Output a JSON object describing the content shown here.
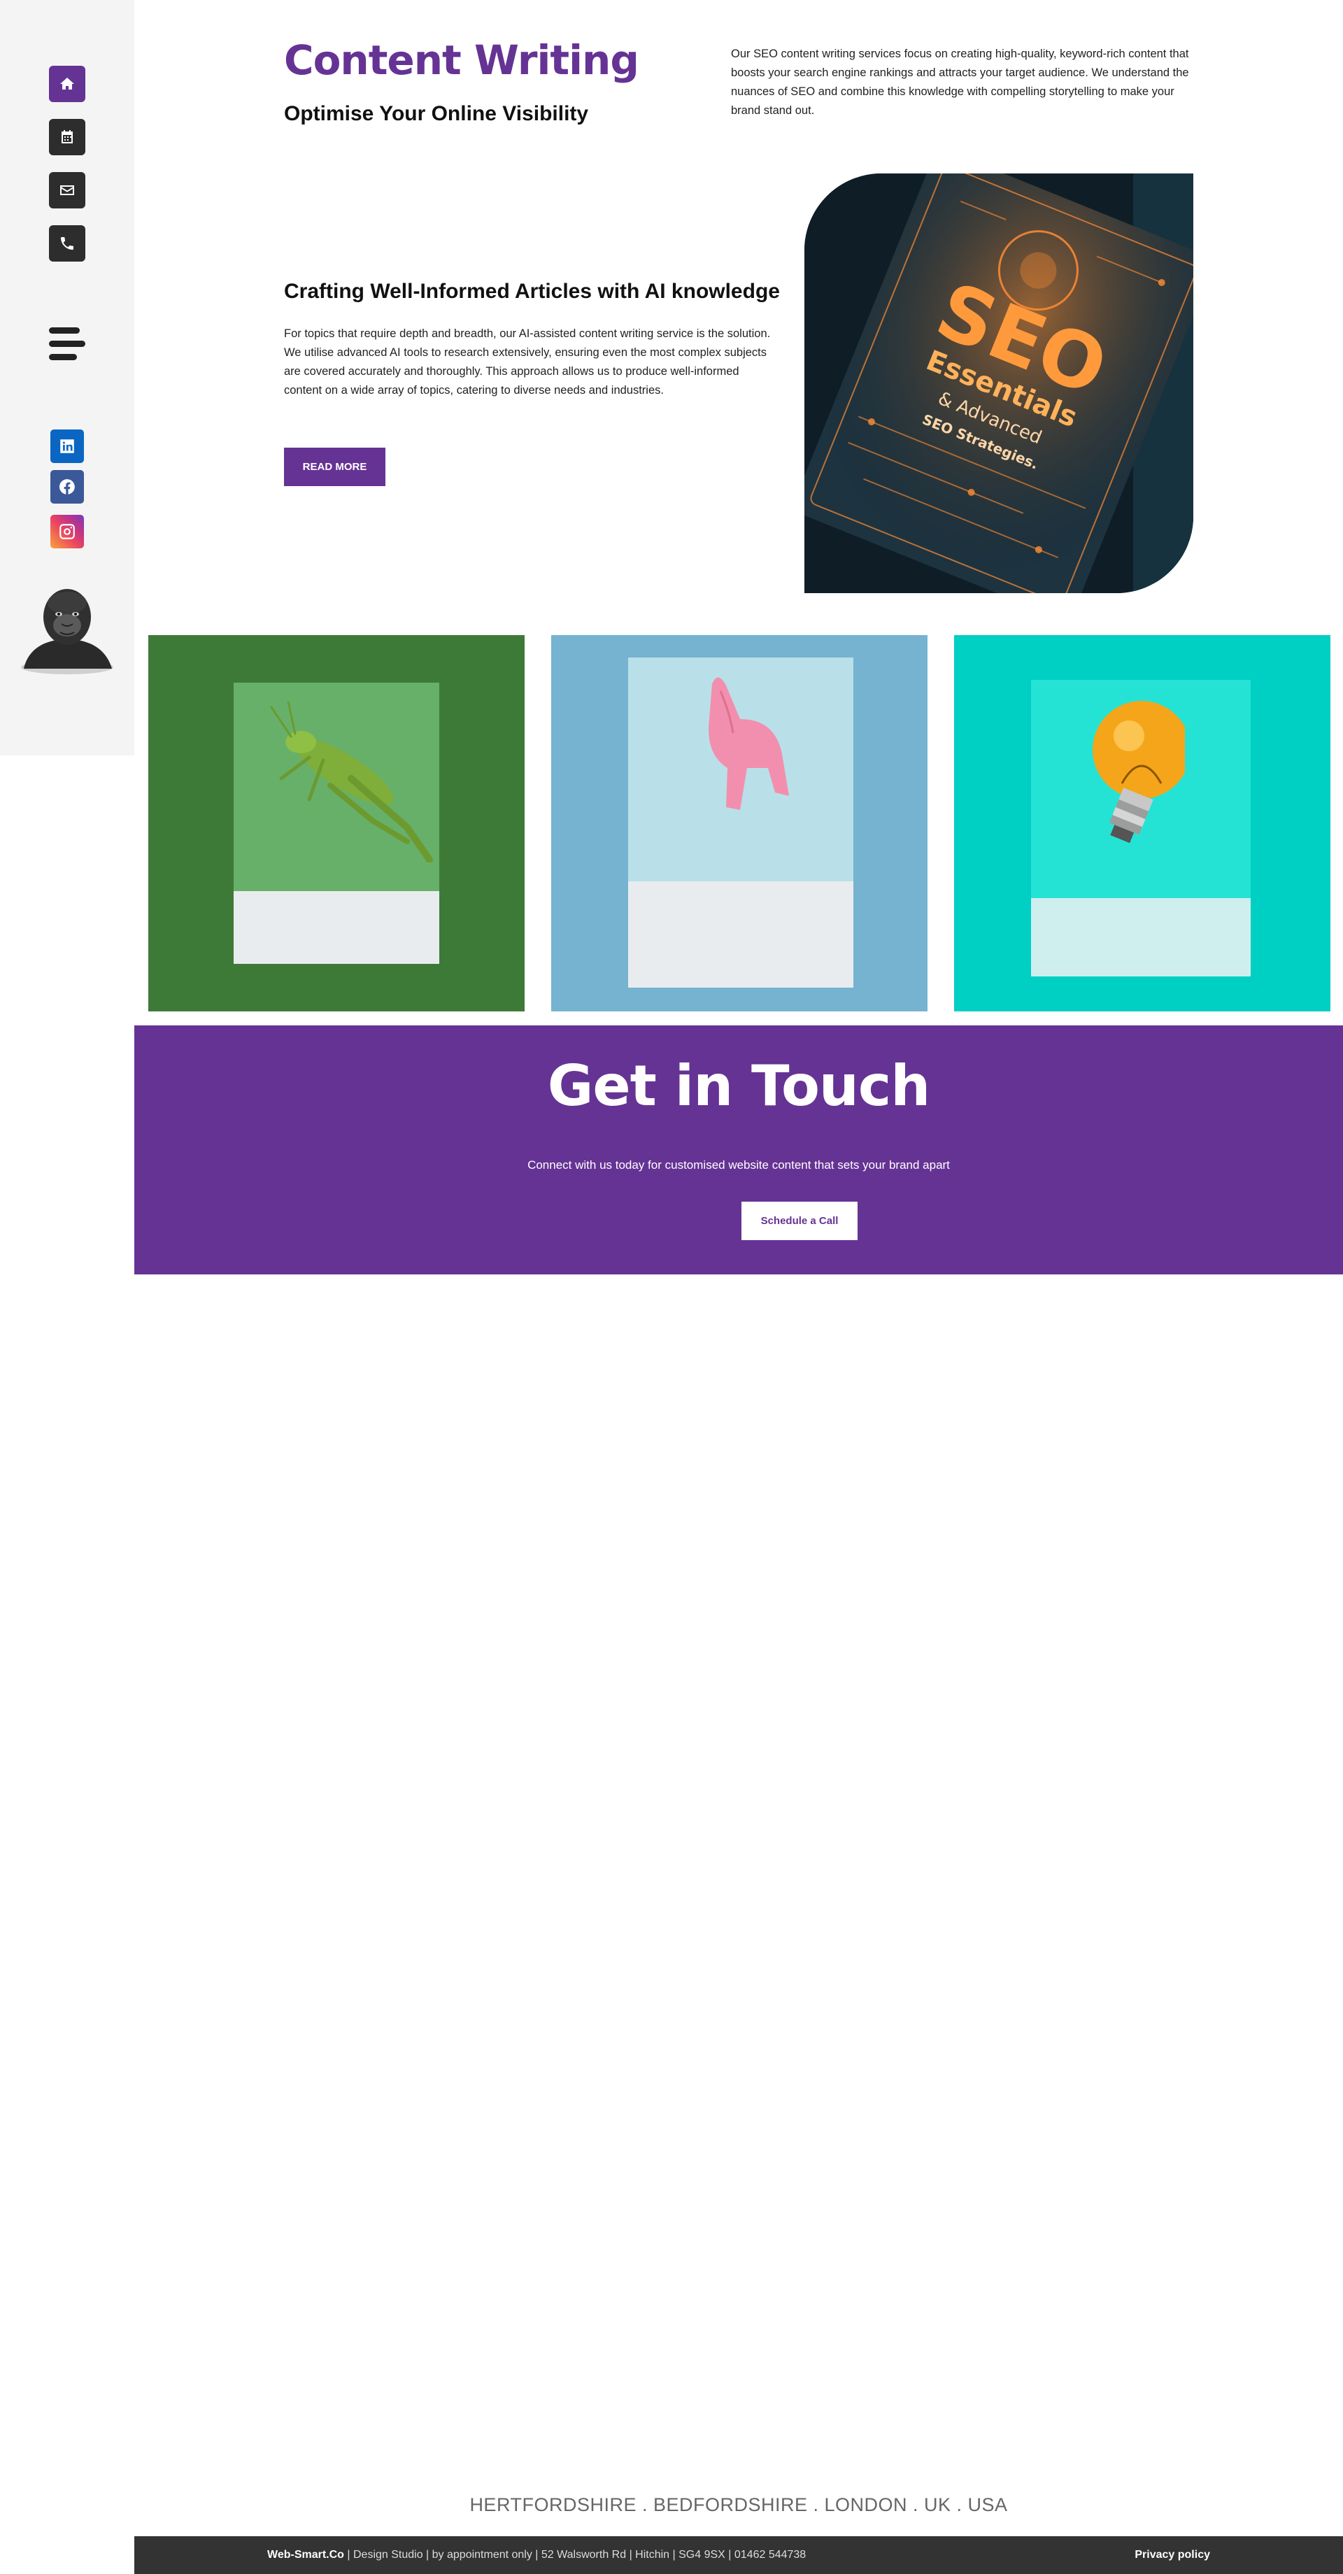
{
  "sidebar": {
    "nav": [
      {
        "name": "home",
        "icon": "home-icon"
      },
      {
        "name": "calendar",
        "icon": "calendar-icon"
      },
      {
        "name": "email",
        "icon": "envelope-icon"
      },
      {
        "name": "phone",
        "icon": "phone-icon"
      }
    ],
    "menu_icon": "hamburger-icon",
    "social": [
      {
        "name": "linkedin",
        "icon": "linkedin-icon",
        "color": "#0A66C2"
      },
      {
        "name": "facebook",
        "icon": "facebook-icon",
        "color": "#3B5998"
      },
      {
        "name": "instagram",
        "icon": "instagram-icon",
        "color": "#E1306C"
      }
    ],
    "mascot_icon": "gorilla-icon"
  },
  "intro": {
    "title": "Content Writing",
    "subtitle": "Optimise Your Online Visibility",
    "description": "Our SEO content writing services focus on creating high-quality, keyword-rich content that boosts your search engine rankings and attracts your target audience. We understand the nuances of SEO and combine this knowledge with compelling storytelling to make your brand stand out."
  },
  "article": {
    "heading": "Crafting Well-Informed Articles with AI knowledge",
    "body": "For topics that require depth and breadth, our AI-assisted content writing service is the solution. We utilise advanced AI tools to research extensively, ensuring even the most complex subjects are covered accurately and thoroughly. This approach allows us to produce well-informed content on a wide array of topics, catering to diverse needs and industries.",
    "button": "READ MORE"
  },
  "seo_image": {
    "big_text": "SEO",
    "line1": "Essentials",
    "line2": "& Advanced",
    "line3": "SEO Strategies."
  },
  "gallery": [
    {
      "name": "grasshopper",
      "bg": "#3E7A37"
    },
    {
      "name": "pink-cat",
      "bg": "#75B3D0"
    },
    {
      "name": "light-bulb",
      "bg": "#00CFC3"
    }
  ],
  "contact": {
    "title": "Get in Touch",
    "text": "Connect with us today for customised website content that sets your brand apart",
    "button": "Schedule a Call"
  },
  "locations": "HERTFORDSHIRE . BEDFORDSHIRE . LONDON . UK . USA",
  "footer": {
    "brand": "Web-Smart.Co",
    "details": " | Design Studio | by appointment only | 52 Walsworth Rd | Hitchin | SG4 9SX | 01462 544738",
    "privacy": "Privacy policy"
  },
  "colors": {
    "accent": "#653394",
    "footer_bg": "#333333",
    "sidebar_bg": "#F4F4F4"
  }
}
